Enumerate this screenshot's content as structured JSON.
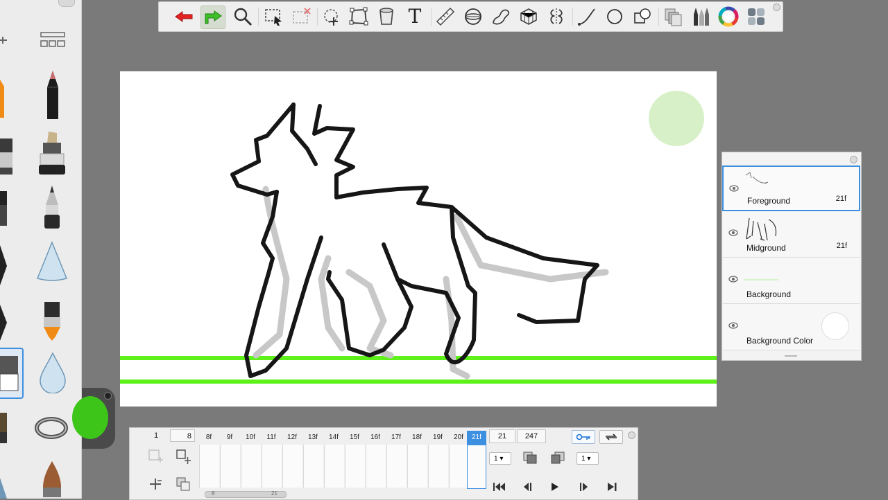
{
  "colors": {
    "background": "#7a7a7a",
    "accent": "#3d8fe0",
    "current_color": "#3ec51a",
    "grass_green": "#5ef21a",
    "sun_green": "#d8f0c8"
  },
  "toolbar": {
    "tools": [
      {
        "name": "undo-icon"
      },
      {
        "name": "redo-icon"
      },
      {
        "name": "zoom-icon"
      },
      {
        "name": "select-rect-icon"
      },
      {
        "name": "select-clear-icon"
      },
      {
        "name": "lasso-icon"
      },
      {
        "name": "transform-icon"
      },
      {
        "name": "fill-bucket-icon"
      },
      {
        "name": "text-icon"
      },
      {
        "name": "ruler-icon"
      },
      {
        "name": "ellipse-guide-icon"
      },
      {
        "name": "french-curve-icon"
      },
      {
        "name": "perspective-icon"
      },
      {
        "name": "symmetry-icon"
      },
      {
        "name": "stroke-icon"
      },
      {
        "name": "shape-icon"
      },
      {
        "name": "layer-shapes-icon"
      },
      {
        "name": "layers-icon"
      },
      {
        "name": "brush-set-icon"
      },
      {
        "name": "color-wheel-icon"
      },
      {
        "name": "copic-swatches-icon"
      }
    ],
    "text_tool_glyph": "T"
  },
  "layers": [
    {
      "name": "Foreground",
      "frames": "21f",
      "selected": true
    },
    {
      "name": "Midground",
      "frames": "21f",
      "selected": false
    },
    {
      "name": "Background",
      "frames": "",
      "selected": false
    },
    {
      "name": "Background Color",
      "frames": "",
      "selected": false
    }
  ],
  "timeline": {
    "start_frame": "1",
    "fps": "8",
    "frames": [
      "8f",
      "9f",
      "10f",
      "11f",
      "12f",
      "13f",
      "14f",
      "15f",
      "16f",
      "17f",
      "18f",
      "19f",
      "20f",
      "21f"
    ],
    "current_frame": "21",
    "total_frames": "247",
    "current_frame_label": "21f",
    "dropdown_left": "1",
    "dropdown_right": "1",
    "scrubber_start": "8",
    "scrubber_end": "21"
  }
}
